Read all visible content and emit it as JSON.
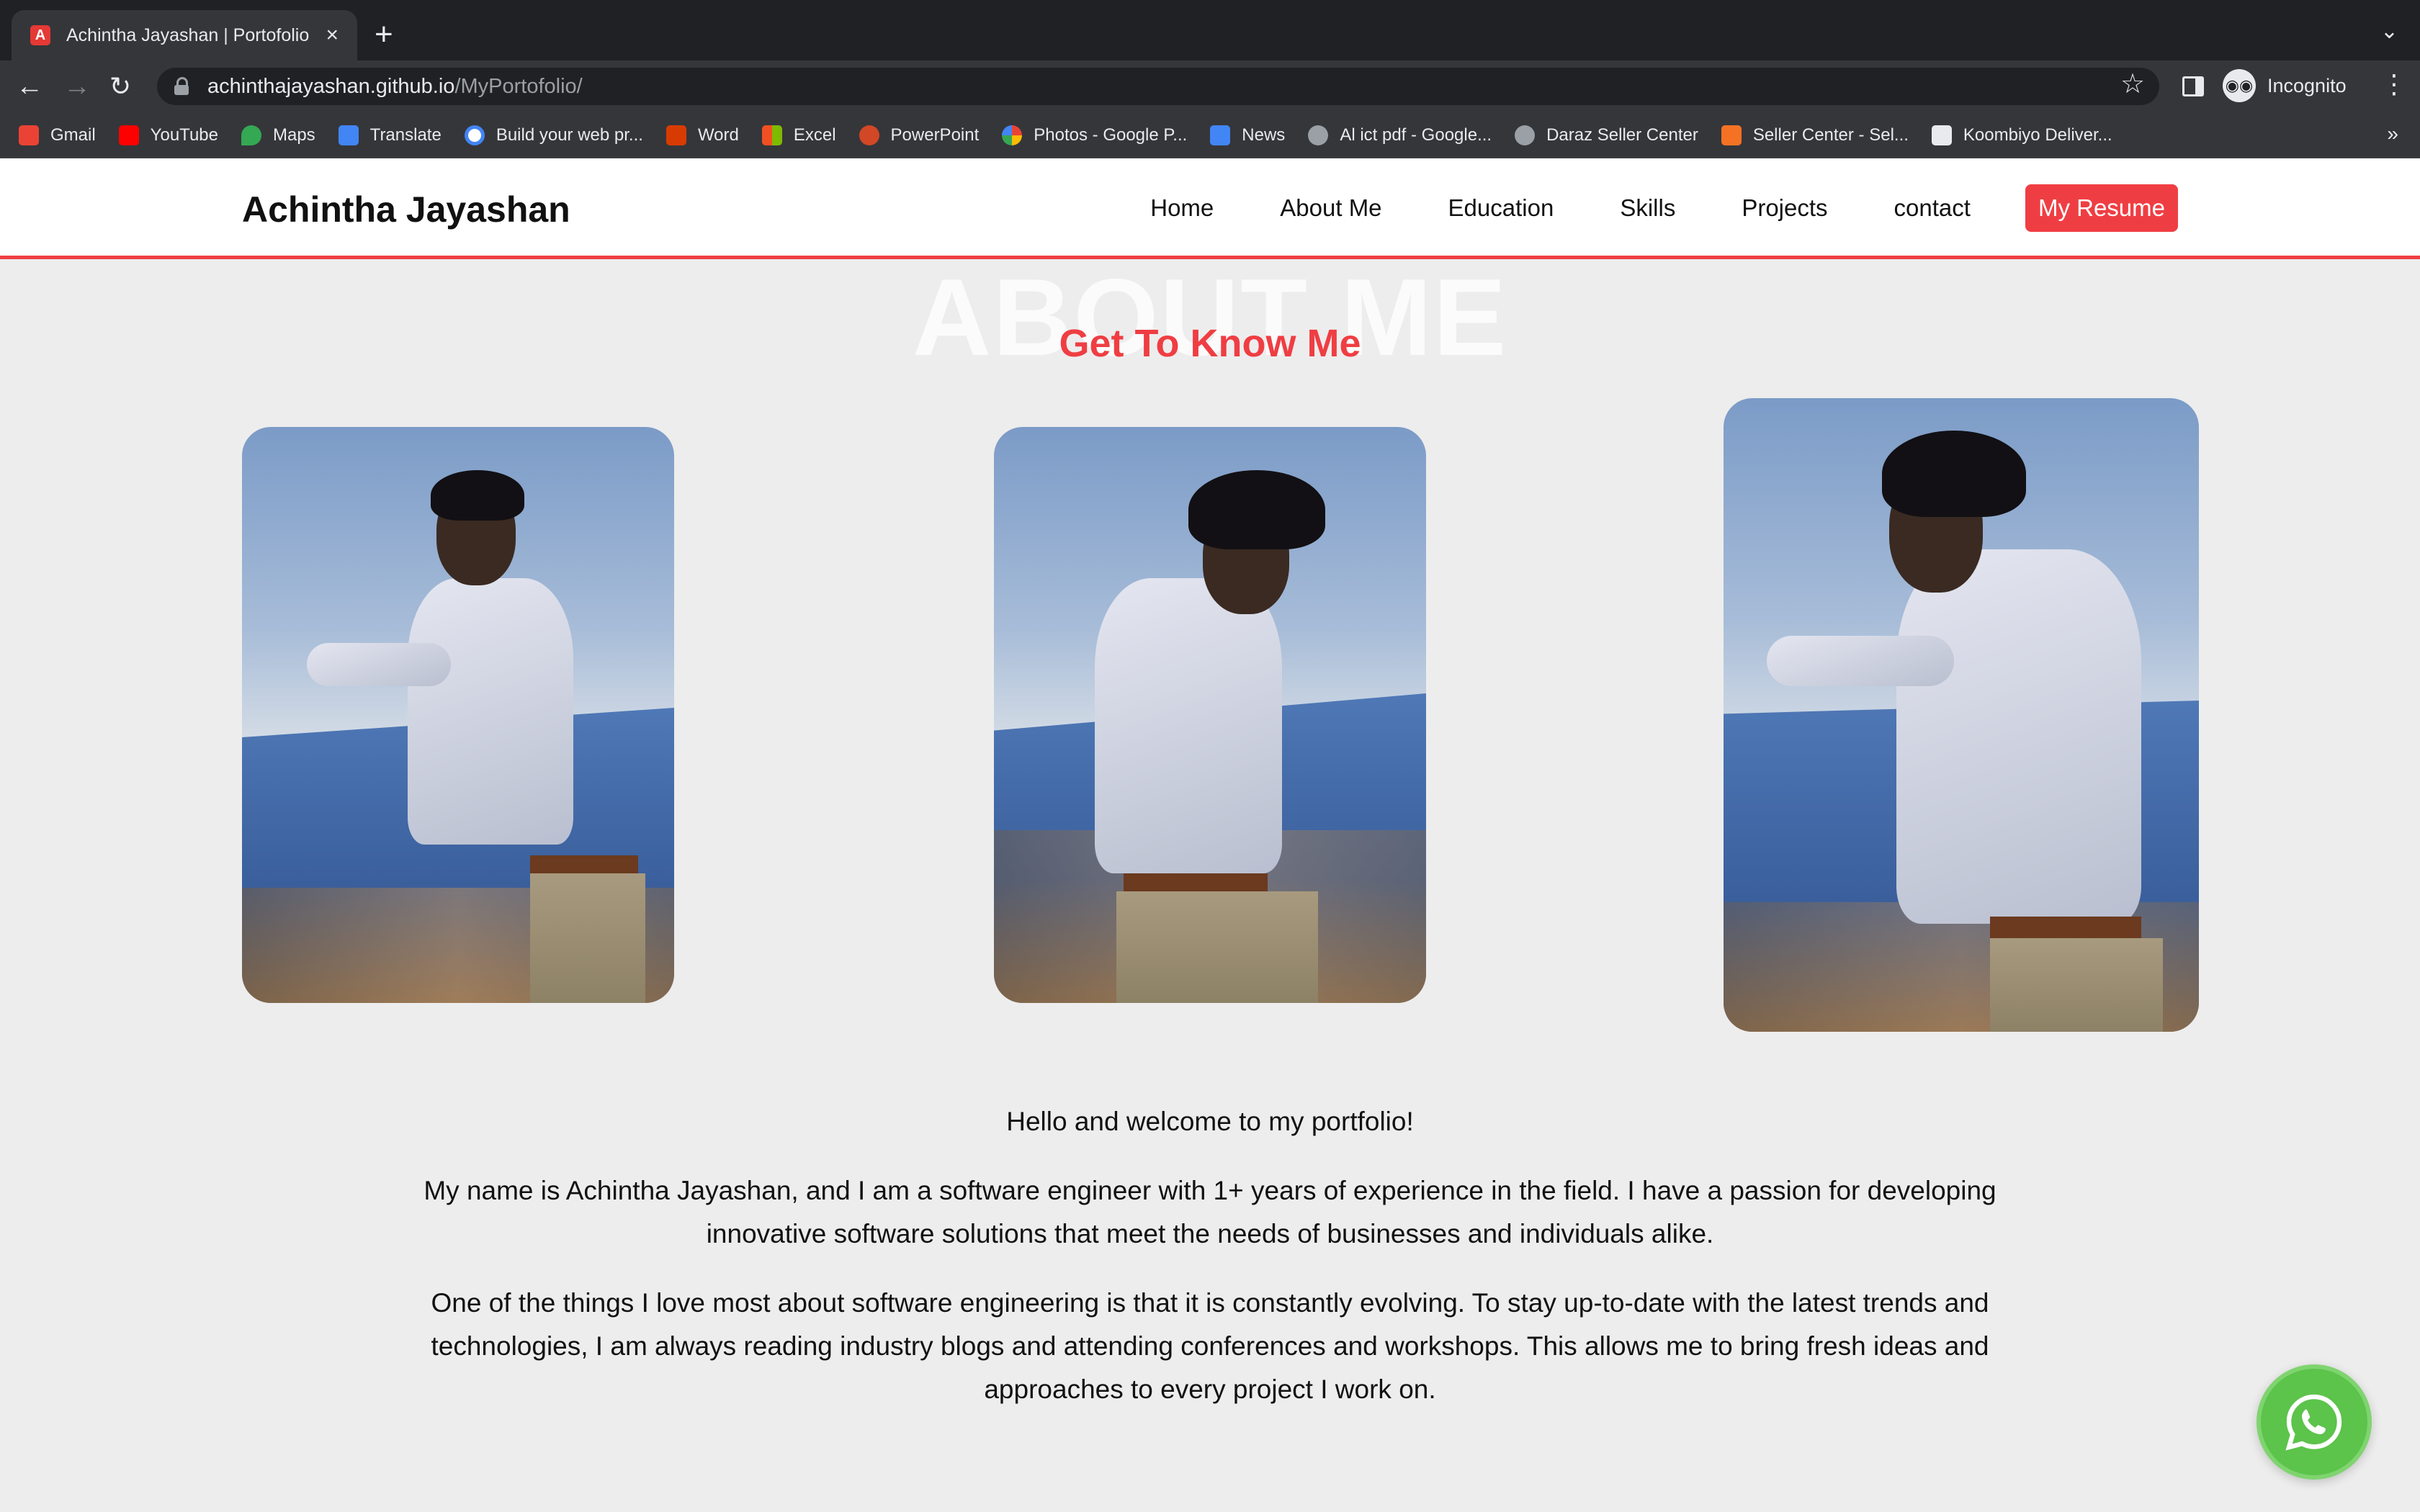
{
  "browser": {
    "tab_title": "Achintha Jayashan | Portofolio",
    "url_host": "achinthajayashan.github.io",
    "url_path": "/MyPortofolio/",
    "profile_label": "Incognito",
    "bookmarks": [
      {
        "label": "Gmail",
        "color": "#ea4335"
      },
      {
        "label": "YouTube",
        "color": "#ff0000"
      },
      {
        "label": "Maps",
        "color": "#34a853"
      },
      {
        "label": "Translate",
        "color": "#4285f4"
      },
      {
        "label": "Build your web pr...",
        "color": "#4285f4"
      },
      {
        "label": "Word",
        "color": "#d83b01"
      },
      {
        "label": "Excel",
        "color": "#f25022"
      },
      {
        "label": "PowerPoint",
        "color": "#d24726"
      },
      {
        "label": "Photos - Google P...",
        "color": "#fbbc04"
      },
      {
        "label": "News",
        "color": "#4285f4"
      },
      {
        "label": "Al ict pdf - Google...",
        "color": "#9aa0a6"
      },
      {
        "label": "Daraz Seller Center",
        "color": "#9aa0a6"
      },
      {
        "label": "Seller Center - Sel...",
        "color": "#f57224"
      },
      {
        "label": "Koombiyo Deliver...",
        "color": "#e8eaed"
      }
    ]
  },
  "site": {
    "logo": "Achintha Jayashan",
    "nav": [
      "Home",
      "About Me",
      "Education",
      "Skills",
      "Projects",
      "contact"
    ],
    "resume_button": "My Resume",
    "accent_color": "#ef3e43"
  },
  "about": {
    "background_title": "ABOUT ME",
    "title": "Get To Know Me",
    "greeting": "Hello and welcome to my portfolio!",
    "paragraph1": "My name is Achintha Jayashan, and I am a software engineer with 1+ years of experience in the field. I have a passion for developing innovative software solutions that meet the needs of businesses and individuals alike.",
    "paragraph2": "One of the things I love most about software engineering is that it is constantly evolving. To stay up-to-date with the latest trends and technologies, I am always reading industry blogs and attending conferences and workshops. This allows me to bring fresh ideas and approaches to every project I work on."
  },
  "icons": {
    "whatsapp": "whatsapp-icon",
    "whatsapp_color": "#5cc34b"
  }
}
